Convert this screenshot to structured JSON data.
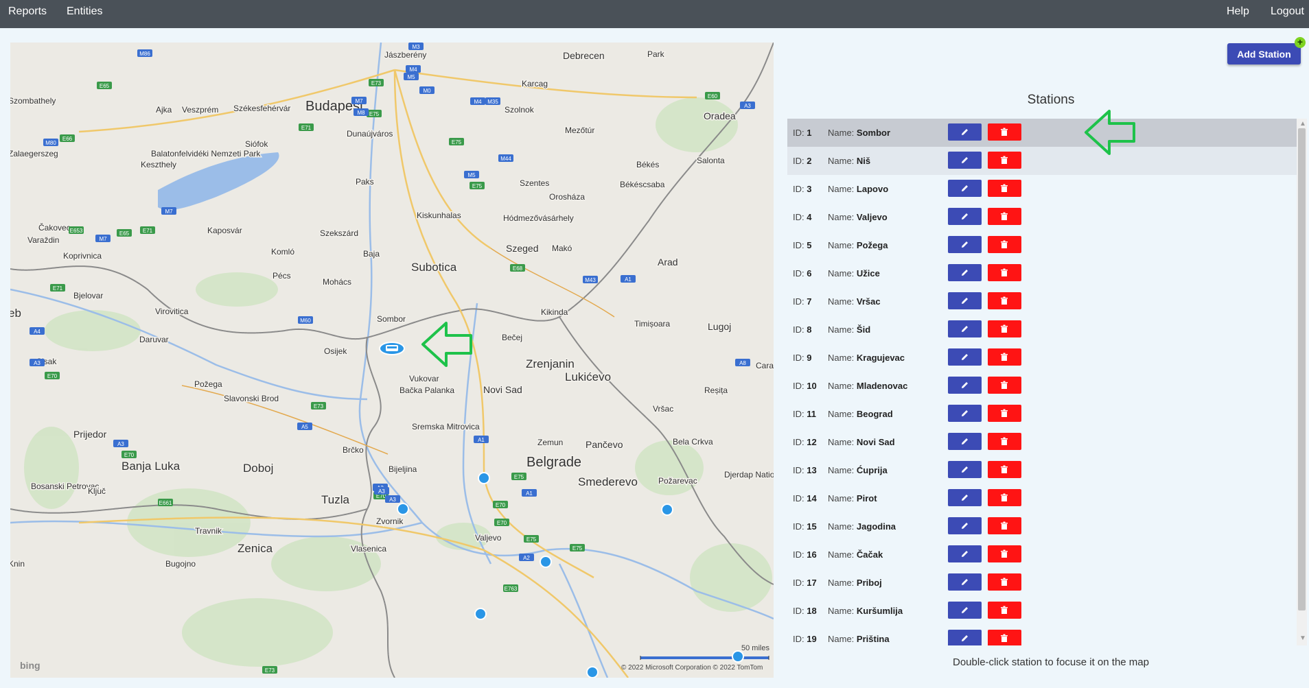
{
  "nav": {
    "reports": "Reports",
    "entities": "Entities",
    "help": "Help",
    "logout": "Logout"
  },
  "map": {
    "cities": [
      {
        "name": "Budapest",
        "size": "xl"
      },
      {
        "name": "Jászberény",
        "size": "sm"
      },
      {
        "name": "Debrecen",
        "size": "md"
      },
      {
        "name": "Szombathely",
        "size": "sm"
      },
      {
        "name": "Ajka",
        "size": "sm"
      },
      {
        "name": "Veszprém",
        "size": "sm"
      },
      {
        "name": "Székesfehérvár",
        "size": "sm"
      },
      {
        "name": "Karcag",
        "size": "sm"
      },
      {
        "name": "Szolnok",
        "size": "sm"
      },
      {
        "name": "Oradea",
        "size": "md"
      },
      {
        "name": "Dunaújváros",
        "size": "sm"
      },
      {
        "name": "Mezőtúr",
        "size": "sm"
      },
      {
        "name": "Zalaegerszeg",
        "size": "sm"
      },
      {
        "name": "Siófok",
        "size": "sm"
      },
      {
        "name": "Keszthely",
        "size": "sm"
      },
      {
        "name": "Békés",
        "size": "sm"
      },
      {
        "name": "Salonta",
        "size": "sm"
      },
      {
        "name": "Paks",
        "size": "sm"
      },
      {
        "name": "Szentes",
        "size": "sm"
      },
      {
        "name": "Békéscsaba",
        "size": "sm"
      },
      {
        "name": "Orosháza",
        "size": "sm"
      },
      {
        "name": "Kiskunhalas",
        "size": "sm"
      },
      {
        "name": "Hódmezővásárhely",
        "size": "sm"
      },
      {
        "name": "Čakovec",
        "size": "sm"
      },
      {
        "name": "Kaposvár",
        "size": "sm"
      },
      {
        "name": "Szekszárd",
        "size": "sm"
      },
      {
        "name": "Varaždin",
        "size": "sm"
      },
      {
        "name": "Komló",
        "size": "sm"
      },
      {
        "name": "Szeged",
        "size": "md"
      },
      {
        "name": "Makó",
        "size": "sm"
      },
      {
        "name": "Koprivnica",
        "size": "sm"
      },
      {
        "name": "Baja",
        "size": "sm"
      },
      {
        "name": "Subotica",
        "size": "lg"
      },
      {
        "name": "Arad",
        "size": "md"
      },
      {
        "name": "Pécs",
        "size": "sm"
      },
      {
        "name": "Mohács",
        "size": "sm"
      },
      {
        "name": "Bjelovar",
        "size": "sm"
      },
      {
        "name": "Virovitica",
        "size": "sm"
      },
      {
        "name": "Sombor",
        "size": "sm"
      },
      {
        "name": "Kikinda",
        "size": "sm"
      },
      {
        "name": "Timișoara",
        "size": "sm"
      },
      {
        "name": "Lugoj",
        "size": "md"
      },
      {
        "name": "Daruvar",
        "size": "sm"
      },
      {
        "name": "Bečej",
        "size": "sm"
      },
      {
        "name": "Osijek",
        "size": "sm"
      },
      {
        "name": "Sisak",
        "size": "sm"
      },
      {
        "name": "Zrenjanin",
        "size": "lg"
      },
      {
        "name": "Vukovar",
        "size": "sm"
      },
      {
        "name": "Lukićevo",
        "size": "lg"
      },
      {
        "name": "Cara",
        "size": "sm"
      },
      {
        "name": "Požega",
        "size": "sm"
      },
      {
        "name": "Bačka Palanka",
        "size": "sm"
      },
      {
        "name": "Novi Sad",
        "size": "md"
      },
      {
        "name": "Slavonski Brod",
        "size": "sm"
      },
      {
        "name": "Reșița",
        "size": "sm"
      },
      {
        "name": "Vršac",
        "size": "sm"
      },
      {
        "name": "Sremska Mitrovica",
        "size": "sm"
      },
      {
        "name": "Prijedor",
        "size": "md"
      },
      {
        "name": "Zemun",
        "size": "sm"
      },
      {
        "name": "Pančevo",
        "size": "md"
      },
      {
        "name": "Bela Crkva",
        "size": "sm"
      },
      {
        "name": "Brčko",
        "size": "sm"
      },
      {
        "name": "Banja Luka",
        "size": "lg"
      },
      {
        "name": "Doboj",
        "size": "lg"
      },
      {
        "name": "Bijeljina",
        "size": "sm"
      },
      {
        "name": "Belgrade",
        "size": "xl"
      },
      {
        "name": "Bosanski Petrovac",
        "size": "sm"
      },
      {
        "name": "Ključ",
        "size": "sm"
      },
      {
        "name": "Smederevo",
        "size": "lg"
      },
      {
        "name": "Požarevac",
        "size": "sm"
      },
      {
        "name": "Djerdap National Park",
        "size": "sm"
      },
      {
        "name": "Tuzla",
        "size": "lg"
      },
      {
        "name": "Zvornik",
        "size": "sm"
      },
      {
        "name": "Valjevo",
        "size": "sm"
      },
      {
        "name": "Travnik",
        "size": "sm"
      },
      {
        "name": "Zenica",
        "size": "lg"
      },
      {
        "name": "Vlasenica",
        "size": "sm"
      },
      {
        "name": "Bugojno",
        "size": "sm"
      },
      {
        "name": "Knin",
        "size": "sm"
      },
      {
        "name": "Balatonfelvidéki Nemzeti Park",
        "size": "sm"
      },
      {
        "name": "eb",
        "size": "lg"
      },
      {
        "name": "Park",
        "size": "sm"
      }
    ],
    "road_shields": [
      "M86",
      "E65",
      "M3",
      "M4",
      "E73",
      "M5",
      "M0",
      "E75",
      "M4",
      "M35",
      "E60",
      "A3",
      "E71",
      "M7",
      "M8",
      "E75",
      "M44",
      "M5",
      "M80",
      "E66",
      "M7",
      "E75",
      "E653",
      "E71",
      "E65",
      "M7",
      "E68",
      "M43",
      "A1",
      "E71",
      "M60",
      "A4",
      "A3",
      "A8",
      "E70",
      "E73",
      "A5",
      "A3",
      "E70",
      "A1",
      "E75",
      "A3",
      "E70",
      "E70",
      "E661",
      "A3",
      "A1",
      "A3",
      "E70",
      "E75",
      "A2",
      "E763",
      "E75",
      "E73"
    ],
    "scale_label": "50 miles",
    "copyright": "© 2022 Microsoft Corporation   © 2022 TomTom",
    "bing_logo": "bing",
    "station_marker_label": "Sombor station"
  },
  "toolbar": {
    "add_station": "Add Station",
    "add_plus": "+"
  },
  "panel": {
    "title": "Stations",
    "id_label": "ID:",
    "name_label": "Name:",
    "hint": "Double-click station to focuse it on the map"
  },
  "stations": [
    {
      "id": "1",
      "name": "Sombor"
    },
    {
      "id": "2",
      "name": "Niš"
    },
    {
      "id": "3",
      "name": "Lapovo"
    },
    {
      "id": "4",
      "name": "Valjevo"
    },
    {
      "id": "5",
      "name": "Požega"
    },
    {
      "id": "6",
      "name": "Užice"
    },
    {
      "id": "7",
      "name": "Vršac"
    },
    {
      "id": "8",
      "name": "Šid"
    },
    {
      "id": "9",
      "name": "Kragujevac"
    },
    {
      "id": "10",
      "name": "Mladenovac"
    },
    {
      "id": "11",
      "name": "Beograd"
    },
    {
      "id": "12",
      "name": "Novi Sad"
    },
    {
      "id": "13",
      "name": "Ćuprija"
    },
    {
      "id": "14",
      "name": "Pirot"
    },
    {
      "id": "15",
      "name": "Jagodina"
    },
    {
      "id": "16",
      "name": "Čačak"
    },
    {
      "id": "17",
      "name": "Priboj"
    },
    {
      "id": "18",
      "name": "Kuršumlija"
    },
    {
      "id": "19",
      "name": "Priština"
    }
  ],
  "colors": {
    "topbar": "#4a5158",
    "edit": "#3c4bb5",
    "delete": "#ff1414",
    "arrow": "#1ec24a",
    "selected_row": "#c7cbd2",
    "page_bg": "#eef6fb"
  }
}
